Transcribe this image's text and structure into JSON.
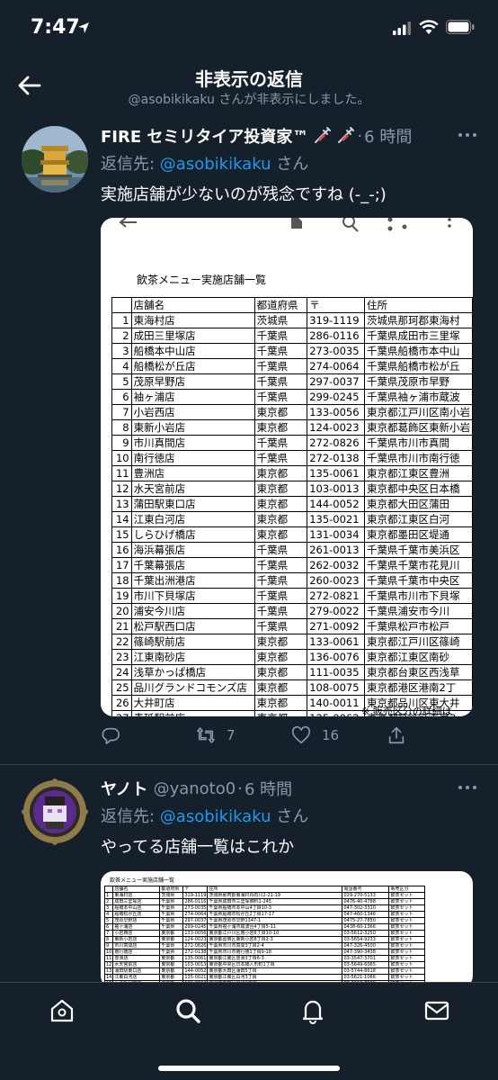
{
  "status": {
    "time": "7:47"
  },
  "header": {
    "title": "非表示の返信",
    "subtitle": "@asobikikaku さんが非表示にしました。"
  },
  "tweets": [
    {
      "display_name": "FIRE セミリタイア投資家™",
      "handle": "",
      "time": "6 時間",
      "reply_prefix": "返信先: ",
      "reply_mention": "@asobikikaku",
      "reply_suffix": " さん",
      "text": "実施店舗が少ないのが残念ですね (-_-;)",
      "retweets": "7",
      "likes": "16",
      "media": {
        "title": "飲茶メニュー実施店舗一覧",
        "headers": [
          "",
          "店舗名",
          "都道府県",
          "〒",
          "住所"
        ],
        "rows": [
          [
            "1",
            "東海村店",
            "茨城県",
            "319-1119",
            "茨城県那珂郡東海村"
          ],
          [
            "2",
            "成田三里塚店",
            "千葉県",
            "286-0116",
            "千葉県成田市三里塚"
          ],
          [
            "3",
            "船橋本中山店",
            "千葉県",
            "273-0035",
            "千葉県船橋市本中山"
          ],
          [
            "4",
            "船橋松が丘店",
            "千葉県",
            "274-0064",
            "千葉県船橋市松が丘"
          ],
          [
            "5",
            "茂原早野店",
            "千葉県",
            "297-0037",
            "千葉県茂原市早野"
          ],
          [
            "6",
            "袖ヶ浦店",
            "千葉県",
            "299-0245",
            "千葉県袖ヶ浦市蔵波"
          ],
          [
            "7",
            "小岩西店",
            "東京都",
            "133-0056",
            "東京都江戸川区南小岩"
          ],
          [
            "8",
            "東新小岩店",
            "東京都",
            "124-0023",
            "東京都葛飾区東新小岩"
          ],
          [
            "9",
            "市川真間店",
            "千葉県",
            "272-0826",
            "千葉県市川市真間"
          ],
          [
            "10",
            "南行徳店",
            "千葉県",
            "272-0138",
            "千葉県市川市南行徳"
          ],
          [
            "11",
            "豊洲店",
            "東京都",
            "135-0061",
            "東京都江東区豊洲"
          ],
          [
            "12",
            "水天宮前店",
            "東京都",
            "103-0013",
            "東京都中央区日本橋"
          ],
          [
            "13",
            "蒲田駅東口店",
            "東京都",
            "144-0052",
            "東京都大田区蒲田"
          ],
          [
            "14",
            "江東白河店",
            "東京都",
            "135-0021",
            "東京都江東区白河"
          ],
          [
            "15",
            "しらひげ橋店",
            "東京都",
            "131-0034",
            "東京都墨田区堤通"
          ],
          [
            "16",
            "海浜幕張店",
            "千葉県",
            "261-0013",
            "千葉県千葉市美浜区"
          ],
          [
            "17",
            "千葉幕張店",
            "千葉県",
            "262-0032",
            "千葉県千葉市花見川"
          ],
          [
            "18",
            "千葉出洲港店",
            "千葉県",
            "260-0023",
            "千葉県千葉市中央区"
          ],
          [
            "19",
            "市川下貝塚店",
            "千葉県",
            "272-0821",
            "千葉県市川市下貝塚"
          ],
          [
            "20",
            "浦安今川店",
            "千葉県",
            "279-0022",
            "千葉県浦安市今川"
          ],
          [
            "21",
            "松戸駅西口店",
            "千葉県",
            "271-0092",
            "千葉県松戸市松戸"
          ],
          [
            "22",
            "篠崎駅前店",
            "東京都",
            "133-0061",
            "東京都江戸川区篠崎"
          ],
          [
            "23",
            "江東南砂店",
            "東京都",
            "136-0076",
            "東京都江東区南砂"
          ],
          [
            "24",
            "浅草かっぱ橋店",
            "東京都",
            "111-0035",
            "東京都台東区西浅草"
          ],
          [
            "25",
            "品川グランドコモンズ店",
            "東京都",
            "108-0075",
            "東京都港区港南2丁"
          ],
          [
            "26",
            "大井町店",
            "東京都",
            "140-0011",
            "東京都品川区東大井"
          ],
          [
            "27",
            "青砥駅前店",
            "東京都",
            "125-0062",
            "東京都葛飾区青戸3"
          ],
          [
            "28",
            "大森駅前店",
            "東京都",
            "143-0023",
            "東京都大田区山王2"
          ],
          [
            "29",
            "川崎田島店",
            "神奈川県",
            "210-0853",
            "神奈川県川崎市川崎"
          ],
          [
            "30",
            "西六郷店",
            "東京都",
            "144-0056",
            "東京都大田区西六郷"
          ]
        ],
        "footer": "※ 販売区分の詳細は"
      }
    },
    {
      "display_name": "ヤノト",
      "handle": "@yanoto0",
      "time": "6 時間",
      "reply_prefix": "返信先: ",
      "reply_mention": "@asobikikaku",
      "reply_suffix": " さん",
      "text": "やってる店舗一覧はこれか",
      "media": {
        "title": "飲茶メニュー実施店舗一覧",
        "headers": [
          "",
          "店舗名",
          "都道府県",
          "〒",
          "住所",
          "電話番号",
          "販売区分"
        ],
        "rows": [
          [
            "1",
            "東海村店",
            "茨城県",
            "319-1119",
            "茨城県那珂郡東海村舟石川2-21-19",
            "029-270-5133",
            "飲茶セット"
          ],
          [
            "2",
            "成田三里塚店",
            "千葉県",
            "286-0116",
            "千葉県成田市三里塚御料1-245",
            "0476-40-4788",
            "飲茶セット"
          ],
          [
            "3",
            "船橋本中山店",
            "千葉県",
            "273-0035",
            "千葉県船橋市本中山4丁目10-3",
            "047-302-3310",
            "飲茶セット"
          ],
          [
            "4",
            "船橋松が丘店",
            "千葉県",
            "274-0064",
            "千葉県船橋市松が丘2丁目17-17",
            "047-460-1346",
            "飲茶セット"
          ],
          [
            "5",
            "茂原早野店",
            "千葉県",
            "297-0037",
            "千葉県茂原市早野1347-1",
            "0475-27-7850",
            "飲茶セット"
          ],
          [
            "6",
            "袖ヶ浦店",
            "千葉県",
            "299-0245",
            "千葉県袖ヶ浦市蔵波台4丁目5-11",
            "0438-60-1366",
            "飲茶セット"
          ],
          [
            "7",
            "小岩西店",
            "東京都",
            "133-0056",
            "東京都江戸川区南小岩6丁目10-10",
            "03-5612-3250",
            "飲茶セット"
          ],
          [
            "8",
            "東新小岩店",
            "東京都",
            "124-0023",
            "東京都葛飾区東新小岩8丁目2-3",
            "03-5654-9233",
            "飲茶セット"
          ],
          [
            "9",
            "市川真間店",
            "千葉県",
            "272-0826",
            "千葉県市川市真間3丁目2-4",
            "047-326-4500",
            "飲茶セット"
          ],
          [
            "10",
            "南行徳店",
            "千葉県",
            "272-0138",
            "千葉県市川市南行徳1丁目9-18",
            "047-390-3438",
            "飲茶セット"
          ],
          [
            "11",
            "豊洲店",
            "東京都",
            "135-0061",
            "東京都江東区豊洲3丁目6-3",
            "03-3547-3701",
            "飲茶セット"
          ],
          [
            "12",
            "水天宮前店",
            "東京都",
            "103-0013",
            "東京都中央区日本橋人形町1丁目",
            "03-5649-6065",
            "飲茶セット"
          ],
          [
            "13",
            "蒲田駅東口店",
            "東京都",
            "144-0052",
            "東京都大田区蒲田5丁目",
            "03-5744-8618",
            "飲茶セット"
          ],
          [
            "14",
            "江東白河店",
            "東京都",
            "135-0021",
            "東京都江東区白河3丁目",
            "03-5621-1066",
            "飲茶セット"
          ],
          [
            "15",
            "しらひげ橋店",
            "東京都",
            "131-0034",
            "東京都墨田区堤通1丁目",
            "03-3610-7235",
            "飲茶セット"
          ]
        ]
      }
    }
  ]
}
